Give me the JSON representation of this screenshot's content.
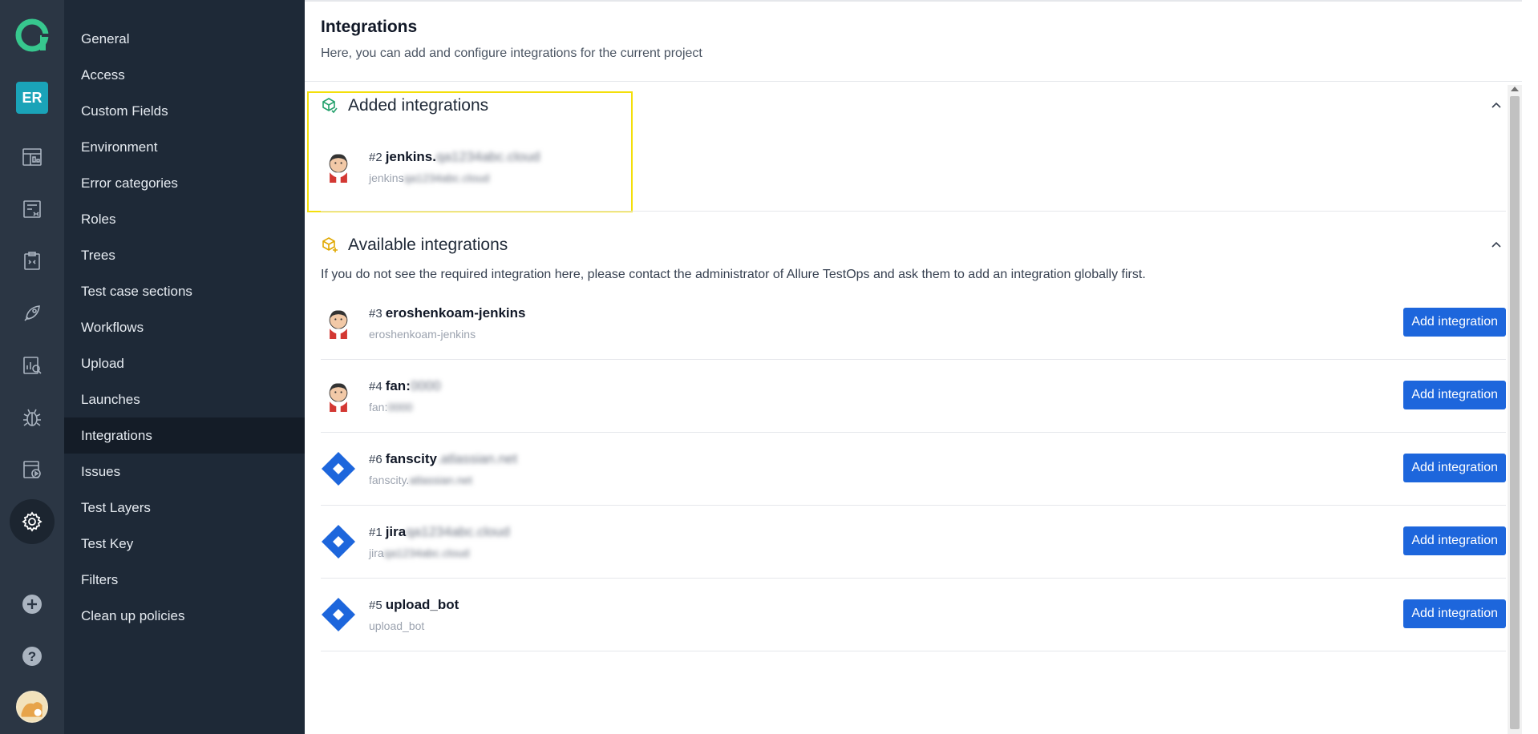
{
  "rail": {
    "project_badge": "ER",
    "icons": [
      "dashboard-icon",
      "test-cases-icon",
      "test-plans-icon",
      "launches-icon",
      "analytics-icon",
      "defects-icon",
      "jobs-icon",
      "settings-icon",
      "add-project-icon",
      "help-icon"
    ]
  },
  "menu": {
    "items": [
      {
        "label": "General"
      },
      {
        "label": "Access"
      },
      {
        "label": "Custom Fields"
      },
      {
        "label": "Environment"
      },
      {
        "label": "Error categories"
      },
      {
        "label": "Roles"
      },
      {
        "label": "Trees"
      },
      {
        "label": "Test case sections"
      },
      {
        "label": "Workflows"
      },
      {
        "label": "Upload"
      },
      {
        "label": "Launches"
      },
      {
        "label": "Integrations"
      },
      {
        "label": "Issues"
      },
      {
        "label": "Test Layers"
      },
      {
        "label": "Test Key"
      },
      {
        "label": "Filters"
      },
      {
        "label": "Clean up policies"
      }
    ],
    "active": "Integrations"
  },
  "page": {
    "title": "Integrations",
    "subtitle": "Here, you can add and configure integrations for the current project"
  },
  "added": {
    "title": "Added integrations",
    "items": [
      {
        "num": "#2",
        "name": "jenkins.",
        "name_blurred": "qa1234abc.cloud",
        "sub": "jenkins",
        "sub_blurred": "qa1234abc.cloud",
        "type": "jenkins"
      }
    ]
  },
  "available": {
    "title": "Available integrations",
    "info": "If you do not see the required integration here, please contact the administrator of Allure TestOps and ask them to add an integration globally first.",
    "button_label": "Add integration",
    "items": [
      {
        "num": "#3",
        "name": "eroshenkoam-jenkins",
        "name_blurred": "",
        "sub": "eroshenkoam-jenkins",
        "sub_blurred": "",
        "type": "jenkins"
      },
      {
        "num": "#4",
        "name": "fan:",
        "name_blurred": "0000",
        "sub": "fan:",
        "sub_blurred": "0000",
        "type": "jenkins"
      },
      {
        "num": "#6",
        "name": "fanscity",
        "name_blurred": ".atlassian.net",
        "sub": "fanscity.",
        "sub_blurred": "atlassian.net",
        "type": "jira"
      },
      {
        "num": "#1",
        "name": "jira",
        "name_blurred": "qa1234abc.cloud",
        "sub": "jira",
        "sub_blurred": "qa1234abc.cloud",
        "type": "jira"
      },
      {
        "num": "#5",
        "name": "upload_bot",
        "name_blurred": "",
        "sub": "upload_bot",
        "sub_blurred": "",
        "type": "jira"
      }
    ]
  },
  "colors": {
    "rail_bg": "#2b3644",
    "menu_bg": "#1e2937",
    "accent_button": "#1d66dc",
    "highlight_border": "#f4df0a",
    "project_badge": "#1aa3b8",
    "added_icon": "#22a06b",
    "available_icon": "#e0a800"
  }
}
